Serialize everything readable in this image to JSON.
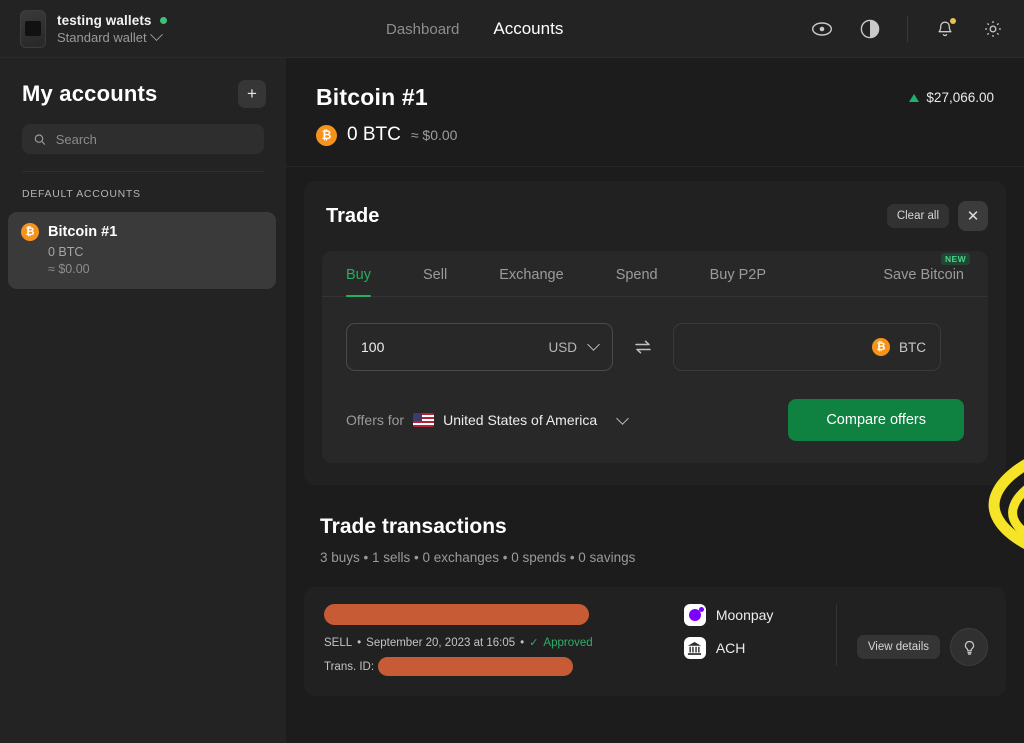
{
  "topbar": {
    "wallet_name": "testing wallets",
    "wallet_type": "Standard wallet",
    "nav": [
      {
        "label": "Dashboard",
        "active": false
      },
      {
        "label": "Accounts",
        "active": true
      }
    ],
    "icons": [
      "eye-icon",
      "contrast-icon",
      "bell-icon",
      "gear-icon"
    ]
  },
  "sidebar": {
    "title": "My accounts",
    "add_label": "+",
    "search": {
      "value": "",
      "placeholder": "Search"
    },
    "section_label": "DEFAULT ACCOUNTS",
    "accounts": [
      {
        "name": "Bitcoin #1",
        "amount": "0 BTC",
        "fiat": "≈ $0.00",
        "symbol": "₿",
        "selected": true
      }
    ]
  },
  "account_header": {
    "title": "Bitcoin #1",
    "symbol": "₿",
    "balance": "0 BTC",
    "balance_fiat": "≈ $0.00",
    "price": "$27,066.00",
    "price_direction": "up",
    "price_color": "#19b36b"
  },
  "trade": {
    "title": "Trade",
    "clear_all_label": "Clear all",
    "close_label": "✕",
    "tabs": [
      {
        "label": "Buy",
        "active": true,
        "badge": ""
      },
      {
        "label": "Sell",
        "active": false,
        "badge": ""
      },
      {
        "label": "Exchange",
        "active": false,
        "badge": ""
      },
      {
        "label": "Spend",
        "active": false,
        "badge": ""
      },
      {
        "label": "Buy P2P",
        "active": false,
        "badge": ""
      },
      {
        "label": "Save Bitcoin",
        "active": false,
        "badge": "NEW"
      }
    ],
    "amount": {
      "value": "100",
      "currency": "USD",
      "placeholder": ""
    },
    "swap_icon": "swap-icon",
    "crypto": {
      "value": "",
      "currency": "BTC",
      "symbol": "₿",
      "placeholder": ""
    },
    "offers_prefix": "Offers for",
    "country": "United States of America",
    "country_flag": "flag-usa",
    "compare_label": "Compare offers",
    "accent_color": "#27ae60",
    "button_color": "#0f8140"
  },
  "transactions": {
    "title": "Trade transactions",
    "summary": "3 buys • 1 sells • 0 exchanges • 0 spends • 0 savings",
    "rows": [
      {
        "redacted_title": "",
        "type": "SELL",
        "date": "September 20, 2023 at 16:05",
        "status": "Approved",
        "status_check": "✓",
        "trans_id_label": "Trans. ID:",
        "trans_id_value": "",
        "provider": "Moonpay",
        "payment_method": "ACH",
        "view_details_label": "View details"
      }
    ]
  },
  "annotation": {
    "type": "hand-drawn-ellipse-highlight",
    "color": "#f5e427",
    "target": "Compare offers"
  }
}
